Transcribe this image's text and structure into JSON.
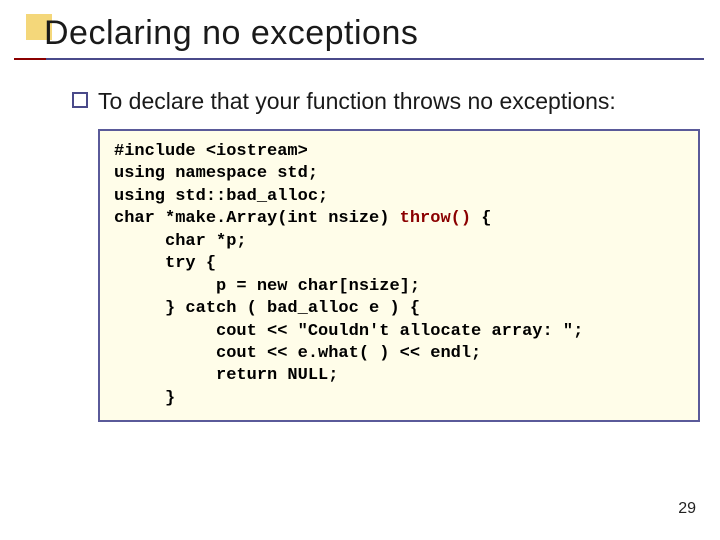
{
  "slide": {
    "title": "Declaring no exceptions",
    "bullet": "To declare that your function throws no exceptions:",
    "page_number": "29"
  },
  "code": {
    "l1": "#include <iostream>",
    "l2": "using namespace std;",
    "l3": "using std::bad_alloc;",
    "l4a": "char *make.Array(int nsize) ",
    "l4b": "throw()",
    "l4c": " {",
    "l5": "     char *p;",
    "l6": "     try {",
    "l7": "          p = new char[nsize];",
    "l8": "     } catch ( bad_alloc e ) {",
    "l9": "          cout << \"Couldn't allocate array: \";",
    "l10": "          cout << e.what( ) << endl;",
    "l11": "          return NULL;",
    "l12": "     }"
  }
}
